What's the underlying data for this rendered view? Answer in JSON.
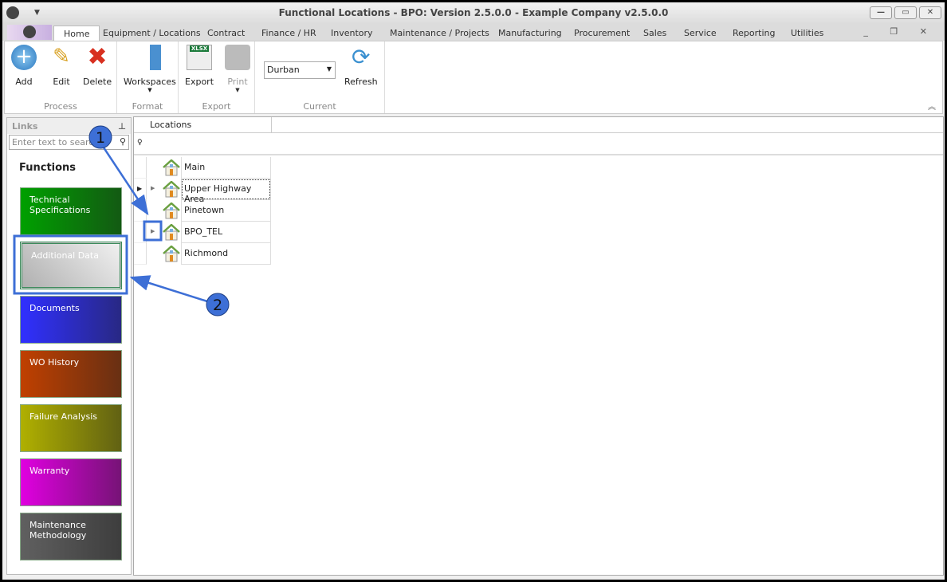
{
  "window": {
    "title": "Functional Locations - BPO: Version 2.5.0.0 - Example Company v2.5.0.0",
    "controls": [
      "—",
      "▭",
      "✕"
    ]
  },
  "tabs": [
    "Home",
    "Equipment / Locations",
    "Contract",
    "Finance / HR",
    "Inventory",
    "Maintenance / Projects",
    "Manufacturing",
    "Procurement",
    "Sales",
    "Service",
    "Reporting",
    "Utilities"
  ],
  "ribbon": {
    "process": {
      "label": "Process",
      "add": "Add",
      "edit": "Edit",
      "delete": "Delete"
    },
    "format": {
      "label": "Format",
      "workspaces": "Workspaces"
    },
    "export": {
      "label": "Export",
      "export": "Export",
      "print": "Print"
    },
    "current": {
      "label": "Current",
      "site": "Durban",
      "refresh": "Refresh"
    }
  },
  "links": {
    "title": "Links",
    "search_placeholder": "Enter text to search...",
    "functions_heading": "Functions",
    "tiles": [
      {
        "label": "Technical Specifications",
        "color": "#00a000"
      },
      {
        "label": "Additional Data",
        "color": "#b0b0b0"
      },
      {
        "label": "Documents",
        "color": "#3030ff"
      },
      {
        "label": "WO History",
        "color": "#c04000"
      },
      {
        "label": "Failure Analysis",
        "color": "#b0b000"
      },
      {
        "label": "Warranty",
        "color": "#e000e0"
      },
      {
        "label": "Maintenance Methodology",
        "color": "#606060"
      }
    ]
  },
  "grid": {
    "column": "Locations",
    "rows": [
      {
        "name": "Main",
        "expandable": false
      },
      {
        "name": "Upper Highway Area",
        "expandable": true,
        "focused": true
      },
      {
        "name": "Pinetown",
        "expandable": false
      },
      {
        "name": "BPO_TEL",
        "expandable": true
      },
      {
        "name": "Richmond",
        "expandable": false
      }
    ]
  },
  "annotations": [
    "1",
    "2"
  ]
}
